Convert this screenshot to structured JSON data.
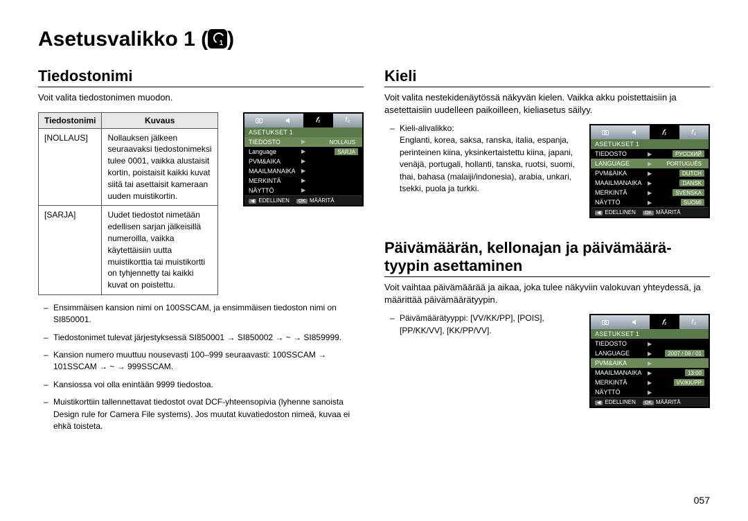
{
  "page": {
    "title_prefix": "Asetusvalikko 1 (",
    "title_suffix": ")",
    "page_number": "057"
  },
  "left": {
    "heading": "Tiedostonimi",
    "intro": "Voit valita tiedostonimen muodon.",
    "table": {
      "head1": "Tiedostonimi",
      "head2": "Kuvaus",
      "row1_name": "[NOLLAUS]",
      "row1_desc": "Nollauksen jälkeen seuraavaksi tiedostonimeksi tulee 0001, vaikka alustaisit kortin, poistaisit kaikki kuvat siitä tai asettaisit kameraan uuden muistikortin.",
      "row2_name": "[SARJA]",
      "row2_desc": "Uudet tiedostot nimetään edellisen sarjan jälkeisillä numeroilla, vaikka käytettäisiin uutta muistikorttia tai muistikortti on tyhjennetty tai kaikki kuvat on poistettu."
    },
    "lcd": {
      "title": "ASETUKSET 1",
      "rows": [
        {
          "lbl": "TIEDOSTO",
          "val": "NOLLAUS",
          "sel": true
        },
        {
          "lbl": "Language",
          "val": "SARJA",
          "sel": false
        },
        {
          "lbl": "PVM&AIKA",
          "val": "",
          "sel": false
        },
        {
          "lbl": "MAAILMANAIKA",
          "val": "",
          "sel": false
        },
        {
          "lbl": "MERKINTÄ",
          "val": "",
          "sel": false
        },
        {
          "lbl": "NÄYTTÖ",
          "val": "",
          "sel": false
        }
      ],
      "foot_left": "EDELLINEN",
      "foot_ok": "OK",
      "foot_right": "MÄÄRITÄ"
    },
    "bullets": [
      "Ensimmäisen kansion nimi on 100SSCAM, ja ensimmäisen tiedoston nimi on SI850001.",
      "Tiedostonimet tulevat järjestyksessä SI850001 → SI850002 → ~ → SI859999.",
      "Kansion numero muuttuu nousevasti 100–999 seuraavasti: 100SSCAM → 101SSCAM → ~ → 999SSCAM.",
      "Kansiossa voi olla enintään 9999 tiedostoa.",
      "Muistikorttiin tallennettavat tiedostot ovat DCF-yhteensopivia (lyhenne sanoista Design rule for Camera File systems). Jos muutat kuvatiedoston nimeä, kuvaa ei ehkä toisteta."
    ]
  },
  "right": {
    "kieli": {
      "heading": "Kieli",
      "intro": "Voit valita nestekidenäytössä näkyvän kielen. Vaikka akku poistettaisiin ja asetettaisiin uudelleen paikoilleen, kieliasetus säilyy.",
      "sub_heading": "Kieli-alivalikko:",
      "sub_body": "Englanti, korea, saksa, ranska, italia, espanja, perinteinen kiina, yksinkertaistettu kiina, japani, venäjä, portugali, hollanti, tanska, ruotsi, suomi, thai, bahasa (malaiji/indonesia), arabia, unkari, tsekki, puola ja turkki.",
      "lcd": {
        "title": "ASETUKSET 1",
        "rows": [
          {
            "lbl": "TIEDOSTO",
            "val": "РУССКИЙ",
            "sel": false
          },
          {
            "lbl": "LANGUAGE",
            "val": "PORTUGUÊS",
            "sel": true
          },
          {
            "lbl": "PVM&AIKA",
            "val": "DUTCH",
            "sel": false
          },
          {
            "lbl": "MAAILMANAIKA",
            "val": "DANSK",
            "sel": false
          },
          {
            "lbl": "MERKINTÄ",
            "val": "SVENSKA",
            "sel": false
          },
          {
            "lbl": "NÄYTTÖ",
            "val": "SUOMI",
            "sel": false
          }
        ],
        "foot_left": "EDELLINEN",
        "foot_ok": "OK",
        "foot_right": "MÄÄRITÄ"
      }
    },
    "date": {
      "heading": "Päivämäärän, kellonajan ja päivämäärä­tyypin asettaminen",
      "intro": "Voit vaihtaa päivämäärää ja aikaa, joka tulee näkyviin valokuvan yhteydessä, ja määrittää päivämäärätyypin.",
      "sub_label": "Päivämäärätyyppi:",
      "sub_values": "[VV/KK/PP], [POIS], [PP/KK/VV], [KK/PP/VV].",
      "lcd": {
        "title": "ASETUKSET 1",
        "rows": [
          {
            "lbl": "TIEDOSTO",
            "val": "",
            "sel": false
          },
          {
            "lbl": "LANGUAGE",
            "val": "2007 / 08 / 01",
            "sel": false
          },
          {
            "lbl": "PVM&AIKA",
            "val": "",
            "sel": true
          },
          {
            "lbl": "MAAILMANAIKA",
            "val": "13:00",
            "sel": false
          },
          {
            "lbl": "MERKINTÄ",
            "val": "VV/KK/PP",
            "sel": false
          },
          {
            "lbl": "NÄYTTÖ",
            "val": "",
            "sel": false
          }
        ],
        "foot_left": "EDELLINEN",
        "foot_ok": "OK",
        "foot_right": "MÄÄRITÄ"
      }
    }
  }
}
